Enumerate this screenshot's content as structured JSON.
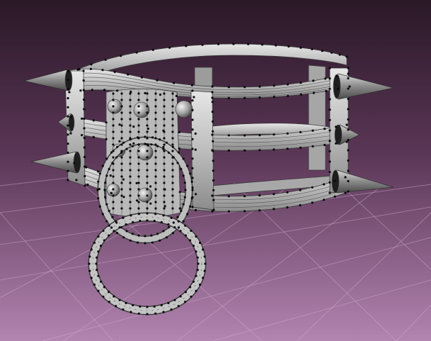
{
  "viewport": {
    "background_top": "#2d1a2a",
    "background_bottom": "#a678a4",
    "grid_line_color": "#c9a8c6"
  },
  "model": {
    "mesh_color": "#c9c9c9",
    "wire_color": "#3a3a3a",
    "vertex_color": "#0a0a0a",
    "spike_color": "#9a9a9a"
  }
}
